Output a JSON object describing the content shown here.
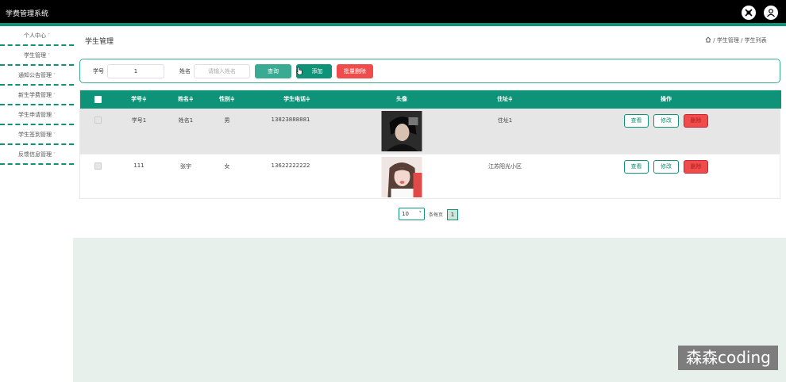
{
  "app": {
    "title": "学费管理系统"
  },
  "header_icons": [
    "settings-icon",
    "user-icon"
  ],
  "sidebar": {
    "items": [
      {
        "label": "个人中心"
      },
      {
        "label": "学生管理"
      },
      {
        "label": "通知公告管理"
      },
      {
        "label": "新生学费管理"
      },
      {
        "label": "学生申请管理"
      },
      {
        "label": "学生签到管理"
      },
      {
        "label": "反馈信息管理"
      }
    ],
    "chevron": "˅"
  },
  "page": {
    "title": "学生管理"
  },
  "breadcrumb": {
    "home_icon": "home-icon",
    "level1": "学生管理",
    "sep": "/",
    "level2": "学生列表"
  },
  "search": {
    "student_no_label": "学号",
    "student_no_value": "1",
    "name_label": "姓名",
    "name_placeholder": "请输入姓名",
    "query_button": "查询",
    "add_button": "添加",
    "batch_delete_button": "批量删除"
  },
  "table": {
    "headers": {
      "student_no": "学号≑",
      "name": "姓名≑",
      "gender": "性别≑",
      "phone": "学生电话≑",
      "avatar": "头像",
      "address": "住址≑",
      "actions": "操作"
    },
    "rows": [
      {
        "student_no": "学号1",
        "name": "姓名1",
        "gender": "男",
        "phone": "13823888881",
        "address": "住址1"
      },
      {
        "student_no": "111",
        "name": "张宇",
        "gender": "女",
        "phone": "13622222222",
        "address": "江苏阳光小区"
      }
    ],
    "view_label": "查看",
    "edit_label": "修改",
    "delete_label": "删除",
    "colors": {
      "header": "#0e9278",
      "selected_row": "#e6e6e6",
      "delete": "#f14c4c"
    }
  },
  "pagination": {
    "page_size": "10",
    "page_size_caret": "˅",
    "per_page_text": "条每页",
    "current_page": "1"
  },
  "watermark": {
    "text": "森森coding"
  }
}
